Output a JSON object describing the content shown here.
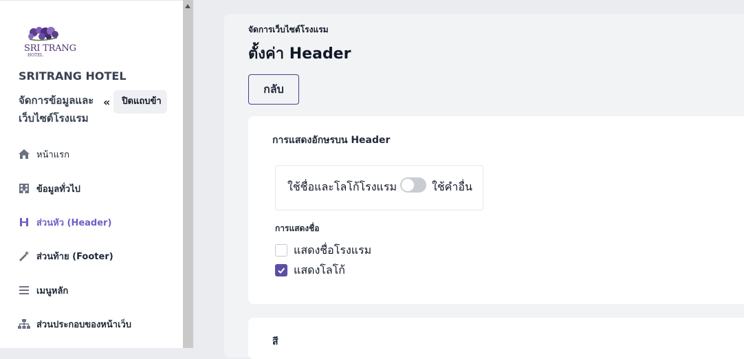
{
  "sidebar": {
    "logo_text": "SRI TRANG",
    "logo_sub": "HOTEL",
    "hotel_name": "SRITRANG HOTEL",
    "hotel_desc": "จัดการข้อมูลและเว็บไซต์โรงแรม",
    "collapse_label": "ปิดแถบข้า",
    "items": [
      {
        "label": "หน้าแรก",
        "icon": "home-icon"
      },
      {
        "label": "ข้อมูลทั่วไป",
        "icon": "building-icon"
      },
      {
        "label": "ส่วนหัว (Header)",
        "icon": "heading-icon"
      },
      {
        "label": "ส่วนท้าย (Footer)",
        "icon": "magic-wand-icon"
      },
      {
        "label": "เมนูหลัก",
        "icon": "menu-icon"
      },
      {
        "label": "ส่วนประกอบของหน้าเว็บ",
        "icon": "sitemap-icon"
      }
    ]
  },
  "main": {
    "breadcrumb": "จัดการเว็บไซต์โรงแรม",
    "title": "ตั้งค่า Header",
    "back_label": "กลับ",
    "header_text_section": {
      "title": "การแสดงอักษรบน Header",
      "toggle_left": "ใช้ชื่อและโลโก้โรงแรม",
      "toggle_right": "ใช้คำอื่น",
      "toggle_on": false,
      "display_label": "การแสดงชื่อ",
      "options": [
        {
          "label": "แสดงชื่อโรงแรม",
          "checked": false
        },
        {
          "label": "แสดงโลโก้",
          "checked": true
        }
      ]
    },
    "color_section": {
      "title": "สี"
    }
  },
  "colors": {
    "accent": "#6d5fc9",
    "checkbox": "#5b4ea3"
  }
}
